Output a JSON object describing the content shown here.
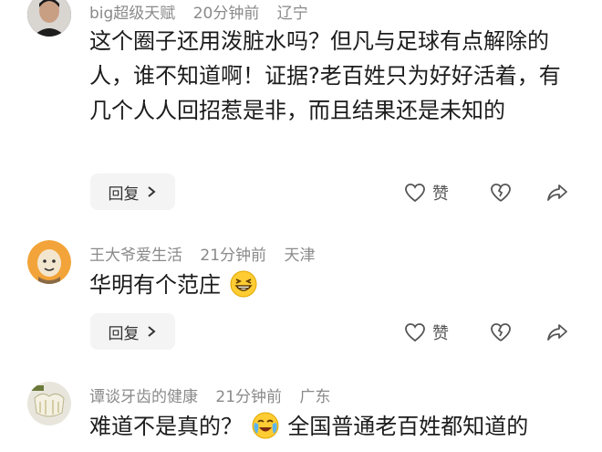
{
  "comments": [
    {
      "username": "big超级天赋",
      "time": "20分钟前",
      "location": "辽宁",
      "content": "这个圈子还用泼脏水吗？但凡与足球有点解除的人，谁不知道啊！证据?老百姓只为好好活着，有几个人人回招惹是非，而且结果还是未知的",
      "reply_label": "回复",
      "like_label": "赞"
    },
    {
      "username": "王大爷爱生活",
      "time": "21分钟前",
      "location": "天津",
      "content": "华明有个范庄",
      "emoji_name": "grinning-squint-emoji",
      "reply_label": "回复",
      "like_label": "赞"
    },
    {
      "username": "谭谈牙齿的健康",
      "time": "21分钟前",
      "location": "广东",
      "content_before": "难道不是真的？",
      "emoji_name": "crying-laughing-emoji",
      "content_after": "全国普通老百姓都知道的"
    }
  ],
  "colors": {
    "meta_text": "#8a8a8a",
    "reply_bg": "#f4f4f5",
    "icon": "#555555"
  }
}
